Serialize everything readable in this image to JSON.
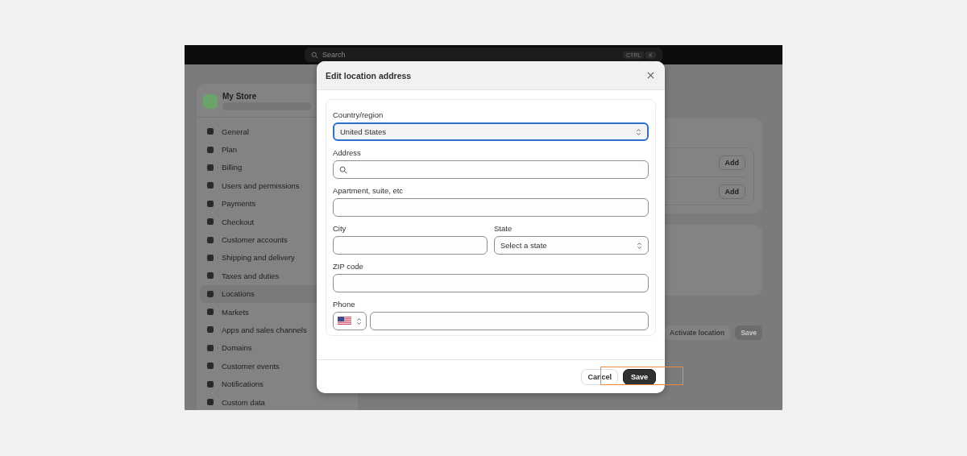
{
  "top_bar": {
    "search": {
      "placeholder": "Search"
    },
    "shortcut": [
      "CTRL",
      "K"
    ]
  },
  "store": {
    "name": "My Store"
  },
  "sidebar": {
    "items": [
      {
        "label": "General",
        "selected": false
      },
      {
        "label": "Plan",
        "selected": false
      },
      {
        "label": "Billing",
        "selected": false
      },
      {
        "label": "Users and permissions",
        "selected": false
      },
      {
        "label": "Payments",
        "selected": false
      },
      {
        "label": "Checkout",
        "selected": false
      },
      {
        "label": "Customer accounts",
        "selected": false
      },
      {
        "label": "Shipping and delivery",
        "selected": false
      },
      {
        "label": "Taxes and duties",
        "selected": false
      },
      {
        "label": "Locations",
        "selected": true
      },
      {
        "label": "Markets",
        "selected": false
      },
      {
        "label": "Apps and sales channels",
        "selected": false
      },
      {
        "label": "Domains",
        "selected": false
      },
      {
        "label": "Customer events",
        "selected": false
      },
      {
        "label": "Notifications",
        "selected": false
      },
      {
        "label": "Custom data",
        "selected": false
      }
    ]
  },
  "background_page": {
    "add_buttons": [
      "Add",
      "Add"
    ],
    "footer_buttons": [
      "Activate location",
      "Save"
    ]
  },
  "dialog": {
    "title": "Edit location address",
    "rows": [
      [
        {
          "kind": "select",
          "label": "Country/region",
          "value": "United States",
          "focused": true
        }
      ],
      [
        {
          "kind": "search",
          "label": "Address",
          "focused": false
        }
      ],
      [
        {
          "kind": "text",
          "label": "Apartment, suite, etc",
          "focused": false
        }
      ],
      [
        {
          "kind": "text",
          "label": "City",
          "focused": false
        },
        {
          "kind": "select",
          "label": "State",
          "placeholder": "Select a state",
          "focused": false
        }
      ],
      [
        {
          "kind": "text",
          "label": "ZIP code",
          "focused": false
        }
      ],
      [
        {
          "kind": "phone",
          "label": "Phone",
          "focused": false
        }
      ]
    ],
    "buttons": [
      {
        "label": "Cancel",
        "kind": "secondary",
        "highlighted": false
      },
      {
        "label": "Save",
        "kind": "primary",
        "highlighted": true
      }
    ]
  }
}
